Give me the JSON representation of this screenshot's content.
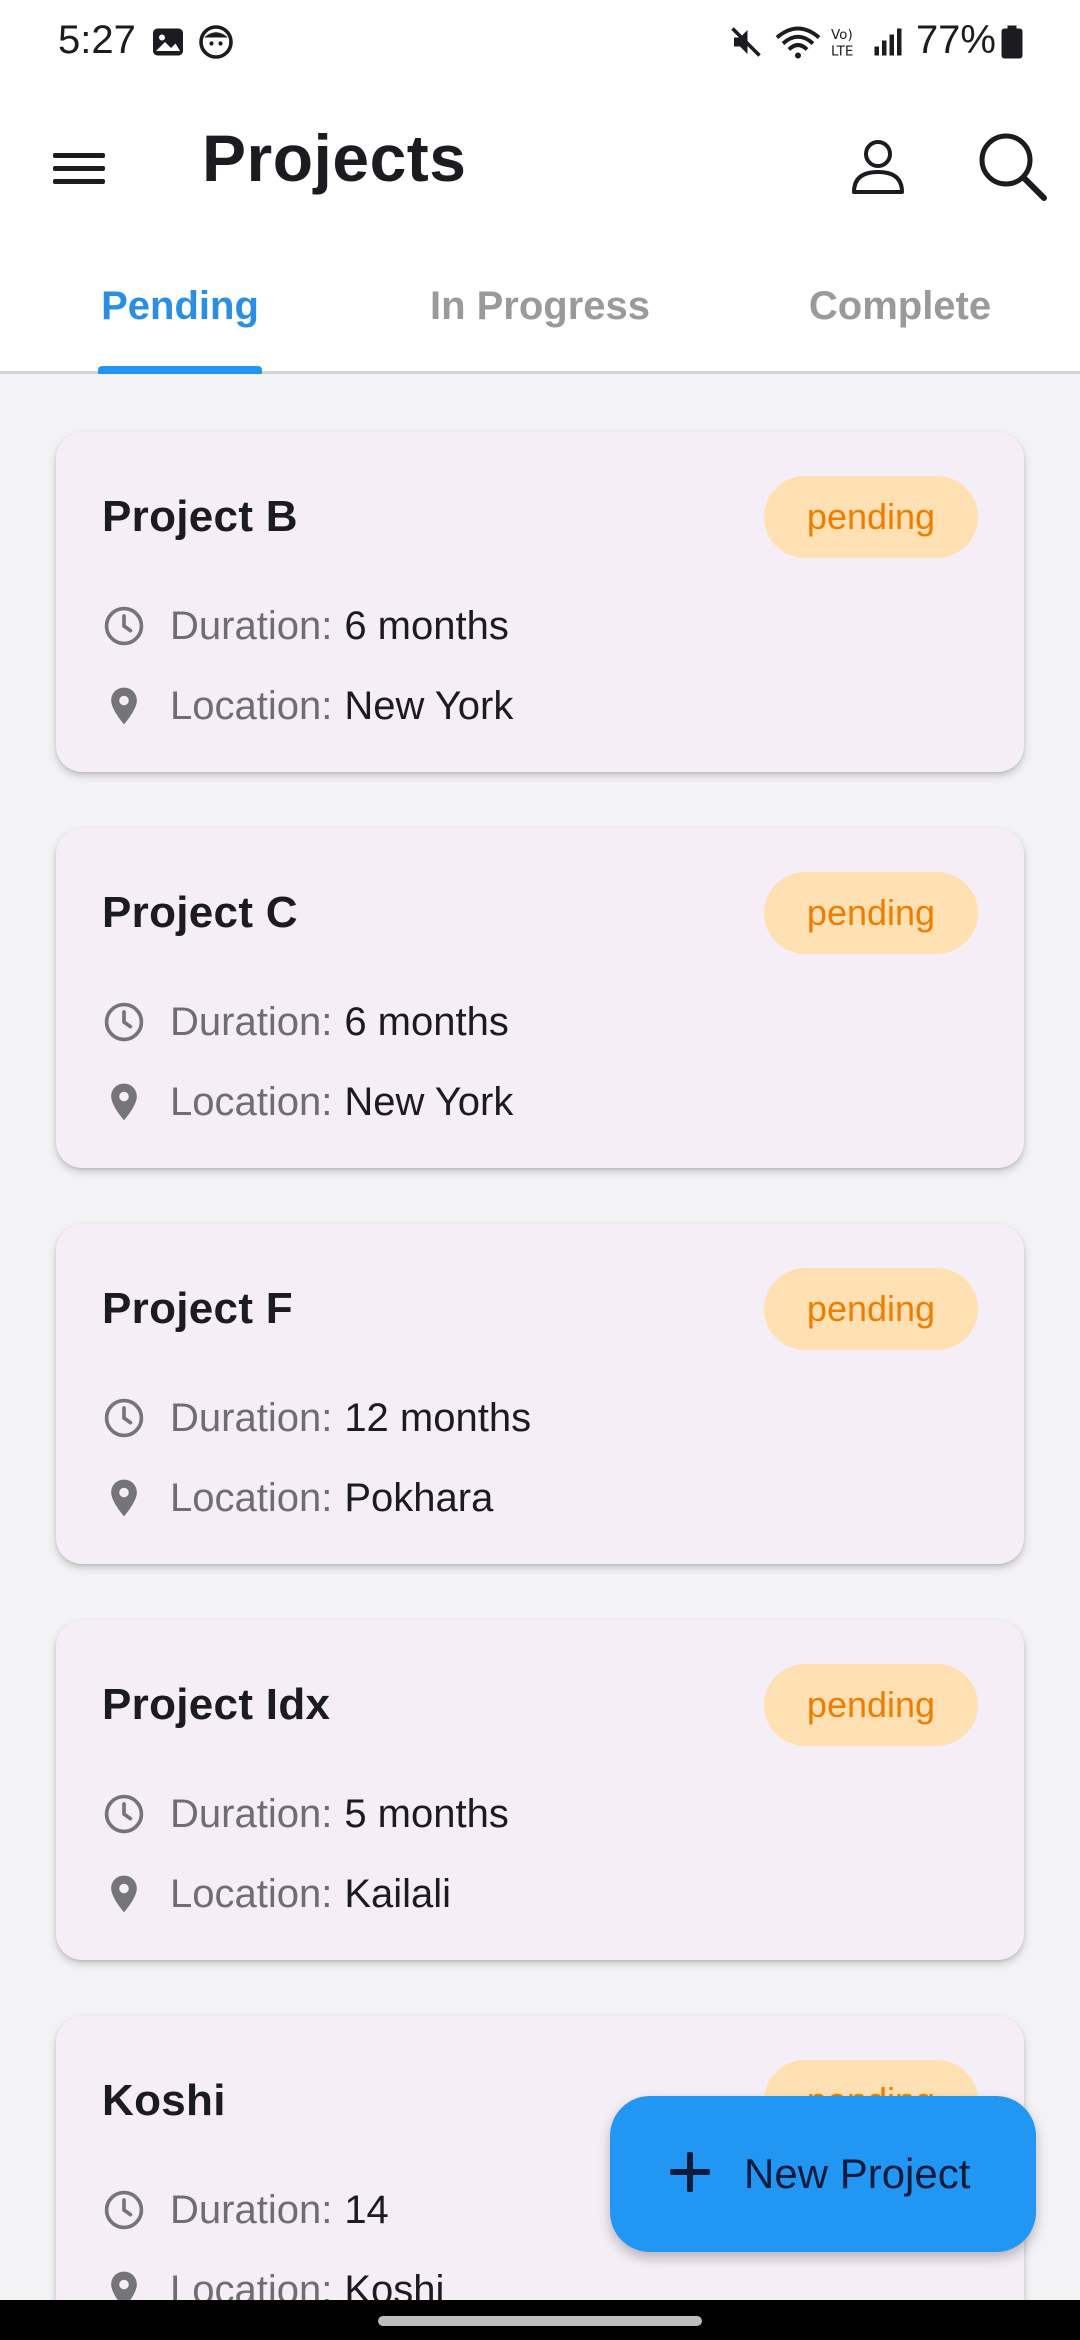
{
  "status_bar": {
    "time": "5:27",
    "battery": "77%",
    "icons": [
      "gallery-icon",
      "face-icon",
      "mute-icon",
      "wifi-icon",
      "volte-icon",
      "signal-icon",
      "battery-icon"
    ]
  },
  "app_bar": {
    "title": "Projects",
    "icons": [
      "menu-icon",
      "account-icon",
      "search-icon"
    ]
  },
  "tabs": [
    {
      "label": "Pending",
      "active": true
    },
    {
      "label": "In Progress",
      "active": false
    },
    {
      "label": "Complete",
      "active": false
    }
  ],
  "projects": [
    {
      "name": "Project B",
      "status": "pending",
      "duration_label": "Duration:",
      "duration": "6 months",
      "location_label": "Location:",
      "location": "New York"
    },
    {
      "name": "Project C",
      "status": "pending",
      "duration_label": "Duration:",
      "duration": "6 months",
      "location_label": "Location:",
      "location": "New York"
    },
    {
      "name": "Project F",
      "status": "pending",
      "duration_label": "Duration:",
      "duration": "12 months",
      "location_label": "Location:",
      "location": "Pokhara"
    },
    {
      "name": "Project Idx",
      "status": "pending",
      "duration_label": "Duration:",
      "duration": "5 months",
      "location_label": "Location:",
      "location": "Kailali"
    },
    {
      "name": "Koshi",
      "status": "pending",
      "duration_label": "Duration:",
      "duration": "14",
      "location_label": "Location:",
      "location": "Koshi"
    }
  ],
  "fab": {
    "label": "New Project",
    "icon": "plus-icon"
  },
  "colors": {
    "accent": "#2196f3",
    "tab_active": "#2a8fe3",
    "badge_bg": "#ffe0b2",
    "badge_text": "#ef7d00",
    "card_bg": "#f5eef7",
    "page_bg": "#f3f2f4"
  }
}
